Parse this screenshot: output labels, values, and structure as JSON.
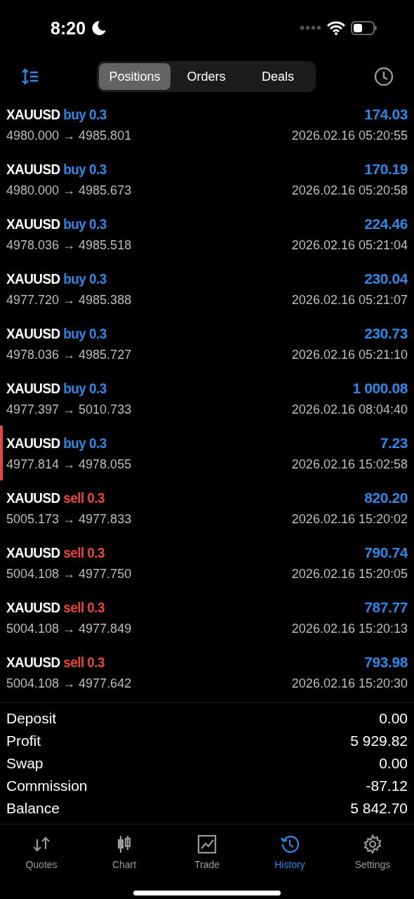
{
  "status_bar": {
    "time": "8:20"
  },
  "tabs": [
    {
      "label": "Positions",
      "selected": true
    },
    {
      "label": "Orders",
      "selected": false
    },
    {
      "label": "Deals",
      "selected": false
    }
  ],
  "deals": [
    {
      "symbol": "XAUUSD",
      "kind": "buy",
      "deal": "buy 0.3",
      "prices": "4980.000 → 4985.801",
      "profit": "174.03",
      "time": "2026.02.16 05:20:55",
      "marked": false
    },
    {
      "symbol": "XAUUSD",
      "kind": "buy",
      "deal": "buy 0.3",
      "prices": "4980.000 → 4985.673",
      "profit": "170.19",
      "time": "2026.02.16 05:20:58",
      "marked": false
    },
    {
      "symbol": "XAUUSD",
      "kind": "buy",
      "deal": "buy 0.3",
      "prices": "4978.036 → 4985.518",
      "profit": "224.46",
      "time": "2026.02.16 05:21:04",
      "marked": false
    },
    {
      "symbol": "XAUUSD",
      "kind": "buy",
      "deal": "buy 0.3",
      "prices": "4977.720 → 4985.388",
      "profit": "230.04",
      "time": "2026.02.16 05:21:07",
      "marked": false
    },
    {
      "symbol": "XAUUSD",
      "kind": "buy",
      "deal": "buy 0.3",
      "prices": "4978.036 → 4985.727",
      "profit": "230.73",
      "time": "2026.02.16 05:21:10",
      "marked": false
    },
    {
      "symbol": "XAUUSD",
      "kind": "buy",
      "deal": "buy 0.3",
      "prices": "4977.397 → 5010.733",
      "profit": "1 000.08",
      "time": "2026.02.16 08:04:40",
      "marked": false
    },
    {
      "symbol": "XAUUSD",
      "kind": "buy",
      "deal": "buy 0.3",
      "prices": "4977.814 → 4978.055",
      "profit": "7.23",
      "time": "2026.02.16 15:02:58",
      "marked": true
    },
    {
      "symbol": "XAUUSD",
      "kind": "sell",
      "deal": "sell 0.3",
      "prices": "5005.173 → 4977.833",
      "profit": "820.20",
      "time": "2026.02.16 15:20:02",
      "marked": false
    },
    {
      "symbol": "XAUUSD",
      "kind": "sell",
      "deal": "sell 0.3",
      "prices": "5004.108 → 4977.750",
      "profit": "790.74",
      "time": "2026.02.16 15:20:05",
      "marked": false
    },
    {
      "symbol": "XAUUSD",
      "kind": "sell",
      "deal": "sell 0.3",
      "prices": "5004.108 → 4977.849",
      "profit": "787.77",
      "time": "2026.02.16 15:20:13",
      "marked": false
    },
    {
      "symbol": "XAUUSD",
      "kind": "sell",
      "deal": "sell 0.3",
      "prices": "5004.108 → 4977.642",
      "profit": "793.98",
      "time": "2026.02.16 15:20:30",
      "marked": false
    }
  ],
  "summary": [
    {
      "label": "Deposit",
      "value": "0.00"
    },
    {
      "label": "Profit",
      "value": "5 929.82"
    },
    {
      "label": "Swap",
      "value": "0.00"
    },
    {
      "label": "Commission",
      "value": "-87.12"
    },
    {
      "label": "Balance",
      "value": "5 842.70"
    }
  ],
  "nav": [
    {
      "kind": "quotes",
      "label": "Quotes",
      "selected": false
    },
    {
      "kind": "chart",
      "label": "Chart",
      "selected": false
    },
    {
      "kind": "trade",
      "label": "Trade",
      "selected": false
    },
    {
      "kind": "history",
      "label": "History",
      "selected": true
    },
    {
      "kind": "settings",
      "label": "Settings",
      "selected": false
    }
  ]
}
